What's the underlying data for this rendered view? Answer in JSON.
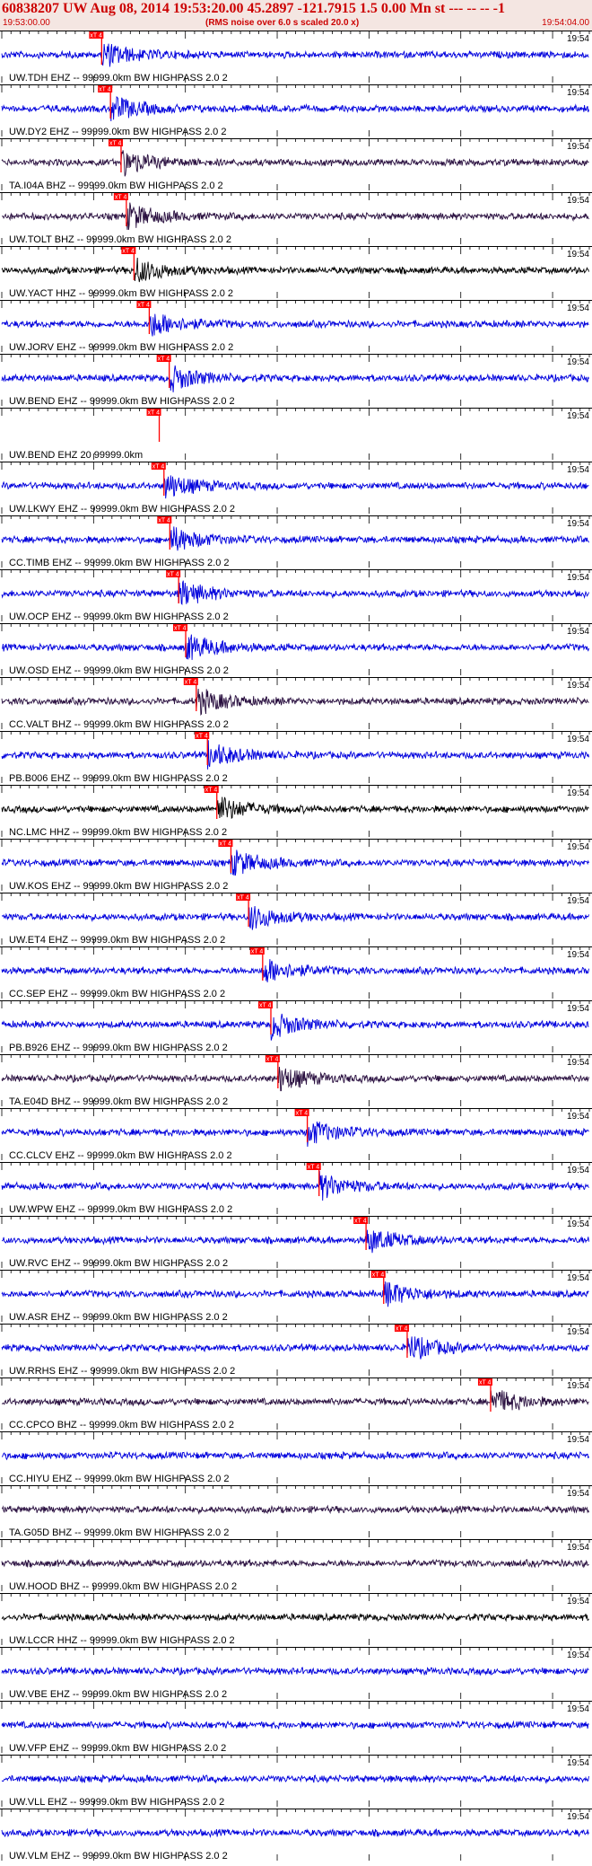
{
  "header": {
    "title": "60838207 UW Aug 08, 2014 19:53:20.00   45.2897 -121.7915  1.5 0.00 Mn st --- -- --  -1",
    "start_time": "19:53:00.00",
    "scaling_note": "(RMS noise over 6.0 s scaled 20.0 x)",
    "end_time": "19:54:04.00"
  },
  "time_label": "19:54",
  "pick_label": "xT 4",
  "colors": {
    "blue": "#0000dd",
    "dark": "#2a1040",
    "black": "#000000",
    "pick": "#ff0000"
  },
  "traces": [
    {
      "label": "UW.TDH EHZ -- 99999.0km BW  HIGHPASS  2.0  2",
      "color": "blue",
      "pick_frac": 0.17
    },
    {
      "label": "UW.DY2 EHZ -- 99999.0km BW  HIGHPASS  2.0  2",
      "color": "blue",
      "pick_frac": 0.185
    },
    {
      "label": "TA.I04A BHZ -- 99999.0km BW  HIGHPASS  2.0  2",
      "color": "dark",
      "pick_frac": 0.203
    },
    {
      "label": "UW.TOLT BHZ -- 99999.0km BW  HIGHPASS  2.0  2",
      "color": "dark",
      "pick_frac": 0.212
    },
    {
      "label": "UW.YACT HHZ -- 99999.0km BW  HIGHPASS  2.0  2",
      "color": "black",
      "pick_frac": 0.225
    },
    {
      "label": "UW.JORV EHZ -- 99999.0km BW  HIGHPASS  2.0  2",
      "color": "blue",
      "pick_frac": 0.251
    },
    {
      "label": "UW.BEND EHZ -- 99999.0km BW  HIGHPASS  2.0  2",
      "color": "blue",
      "pick_frac": 0.285
    },
    {
      "label": "UW.BEND EHZ 20 99999.0km",
      "color": "blue",
      "pick_frac": 0.268,
      "flat": true
    },
    {
      "label": "UW.LKWY EHZ -- 99999.0km BW  HIGHPASS  2.0  2",
      "color": "blue",
      "pick_frac": 0.276
    },
    {
      "label": "CC.TIMB EHZ -- 99999.0km BW  HIGHPASS  2.0  2",
      "color": "blue",
      "pick_frac": 0.286
    },
    {
      "label": "UW.OCP EHZ -- 99999.0km BW  HIGHPASS  2.0  2",
      "color": "blue",
      "pick_frac": 0.301
    },
    {
      "label": "UW.OSD EHZ -- 99999.0km BW  HIGHPASS  2.0  2",
      "color": "blue",
      "pick_frac": 0.313
    },
    {
      "label": "CC.VALT BHZ -- 99999.0km BW  HIGHPASS  2.0  2",
      "color": "dark",
      "pick_frac": 0.331
    },
    {
      "label": "PB.B006 EHZ -- 99999.0km BW  HIGHPASS  2.0  2",
      "color": "blue",
      "pick_frac": 0.35
    },
    {
      "label": "NC.LMC HHZ -- 99999.0km BW  HIGHPASS  2.0  2",
      "color": "black",
      "pick_frac": 0.366
    },
    {
      "label": "UW.KOS EHZ -- 99999.0km BW  HIGHPASS  2.0  2",
      "color": "blue",
      "pick_frac": 0.39
    },
    {
      "label": "UW.ET4 EHZ -- 99999.0km BW  HIGHPASS  2.0  2",
      "color": "blue",
      "pick_frac": 0.42
    },
    {
      "label": "CC.SEP EHZ -- 99999.0km BW  HIGHPASS  2.0  2",
      "color": "blue",
      "pick_frac": 0.444
    },
    {
      "label": "PB.B926 EHZ -- 99999.0km BW  HIGHPASS  2.0  2",
      "color": "blue",
      "pick_frac": 0.458
    },
    {
      "label": "TA.E04D BHZ -- 99999.0km BW  HIGHPASS  2.0  2",
      "color": "dark",
      "pick_frac": 0.47
    },
    {
      "label": "CC.CLCV EHZ -- 99999.0km BW  HIGHPASS  2.0  2",
      "color": "blue",
      "pick_frac": 0.52
    },
    {
      "label": "UW.WPW EHZ -- 99999.0km BW  HIGHPASS  2.0  2",
      "color": "blue",
      "pick_frac": 0.54
    },
    {
      "label": "UW.RVC EHZ -- 99999.0km BW  HIGHPASS  2.0  2",
      "color": "blue",
      "pick_frac": 0.62
    },
    {
      "label": "UW.ASR EHZ -- 99999.0km BW  HIGHPASS  2.0  2",
      "color": "blue",
      "pick_frac": 0.65
    },
    {
      "label": "UW.RRHS EHZ -- 99999.0km BW  HIGHPASS  2.0  2",
      "color": "blue",
      "pick_frac": 0.69
    },
    {
      "label": "CC.CPCO BHZ -- 99999.0km BW  HIGHPASS  2.0  2",
      "color": "dark",
      "pick_frac": 0.832
    },
    {
      "label": "CC.HIYU EHZ -- 99999.0km BW  HIGHPASS  2.0  2",
      "color": "blue"
    },
    {
      "label": "TA.G05D BHZ -- 99999.0km BW  HIGHPASS  2.0  2",
      "color": "dark"
    },
    {
      "label": "UW.HOOD BHZ -- 99999.0km BW  HIGHPASS  2.0  2",
      "color": "dark"
    },
    {
      "label": "UW.LCCR HHZ -- 99999.0km BW  HIGHPASS  2.0  2",
      "color": "black"
    },
    {
      "label": "UW.VBE EHZ -- 99999.0km BW  HIGHPASS  2.0  2",
      "color": "blue"
    },
    {
      "label": "UW.VFP EHZ -- 99999.0km BW  HIGHPASS  2.0  2",
      "color": "blue"
    },
    {
      "label": "UW.VLL EHZ -- 99999.0km BW  HIGHPASS  2.0  2",
      "color": "blue"
    },
    {
      "label": "UW.VLM EHZ -- 99999.0km BW  HIGHPASS  2.0  2",
      "color": "blue"
    }
  ]
}
